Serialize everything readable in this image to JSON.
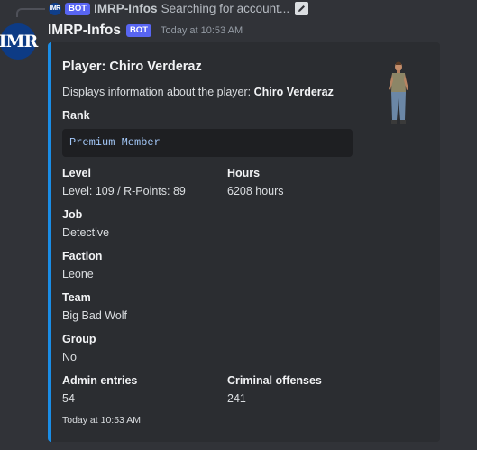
{
  "reply": {
    "avatar_text": "IMR",
    "bot_tag": "BOT",
    "author": "IMRP-Infos",
    "text": "Searching for account..."
  },
  "message": {
    "avatar_text": "IMR",
    "author": "IMRP-Infos",
    "bot_tag": "BOT",
    "timestamp": "Today at 10:53 AM"
  },
  "embed": {
    "accent_color": "#1a8de6",
    "title": "Player: Chiro Verderaz",
    "description_prefix": "Displays information about the player: ",
    "description_player": "Chiro Verderaz",
    "rank": {
      "name": "Rank",
      "value": "Premium Member"
    },
    "level": {
      "name": "Level",
      "value": "Level: 109 / R-Points: 89"
    },
    "hours": {
      "name": "Hours",
      "value": "6208 hours"
    },
    "job": {
      "name": "Job",
      "value": "Detective"
    },
    "faction": {
      "name": "Faction",
      "value": "Leone"
    },
    "team": {
      "name": "Team",
      "value": "Big Bad Wolf"
    },
    "group": {
      "name": "Group",
      "value": "No"
    },
    "admin_entries": {
      "name": "Admin entries",
      "value": "54"
    },
    "criminal_offenses": {
      "name": "Criminal offenses",
      "value": "241"
    },
    "footer": "Today at 10:53 AM"
  }
}
